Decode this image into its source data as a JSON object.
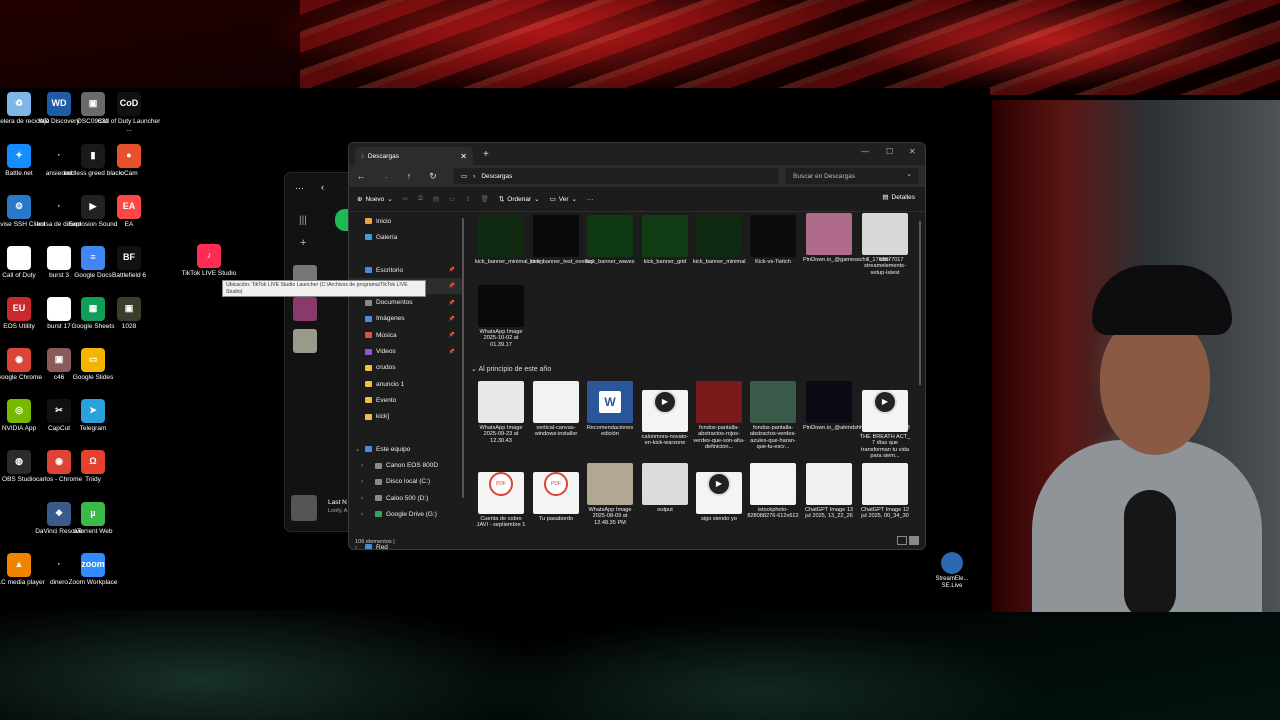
{
  "desktop_icons": [
    {
      "label": "Papelera de reciclaje",
      "icon": "recycle-bin-icon",
      "color": "#7fb6e8",
      "glyph": "♻"
    },
    {
      "label": "WD Discovery",
      "icon": "wd-icon",
      "color": "#1f5ca8",
      "glyph": "WD"
    },
    {
      "label": "DSC09631",
      "icon": "photo-icon",
      "color": "#6a6a6a",
      "glyph": "▣"
    },
    {
      "label": "Call of Duty Launcher ...",
      "icon": "cod-icon",
      "color": "#111111",
      "glyph": "CoD"
    },
    {
      "label": "Battle.net",
      "icon": "battlenet-icon",
      "color": "#148eff",
      "glyph": "✦"
    },
    {
      "label": "ansiedad",
      "icon": "file-icon",
      "color": "#000000",
      "glyph": "·"
    },
    {
      "label": "endless greed black",
      "icon": "file-icon",
      "color": "#1a1a1a",
      "glyph": "▮"
    },
    {
      "label": "oCam",
      "icon": "ocam-icon",
      "color": "#e9512c",
      "glyph": "●"
    },
    {
      "label": "Bitvise SSH Client",
      "icon": "bitvise-icon",
      "color": "#2a79c9",
      "glyph": "⚙"
    },
    {
      "label": "bolsa de dinero",
      "icon": "file-icon",
      "color": "#000000",
      "glyph": "·"
    },
    {
      "label": "Explosion Sound",
      "icon": "media-icon",
      "color": "#222222",
      "glyph": "▶"
    },
    {
      "label": "EA",
      "icon": "ea-icon",
      "color": "#ff4747",
      "glyph": "EA"
    },
    {
      "label": "Call of Duty",
      "icon": "document-icon",
      "color": "#ffffff",
      "glyph": "▤"
    },
    {
      "label": "burst 3",
      "icon": "document-icon",
      "color": "#ffffff",
      "glyph": "▤"
    },
    {
      "label": "Google Docs",
      "icon": "gdocs-icon",
      "color": "#4285f4",
      "glyph": "≡"
    },
    {
      "label": "Battlefield 6",
      "icon": "bf-icon",
      "color": "#111111",
      "glyph": "BF"
    },
    {
      "label": "EOS Utility",
      "icon": "eos-icon",
      "color": "#c9282d",
      "glyph": "EU"
    },
    {
      "label": "burst 17",
      "icon": "document-icon",
      "color": "#ffffff",
      "glyph": "▤"
    },
    {
      "label": "Google Sheets",
      "icon": "gsheets-icon",
      "color": "#0f9d58",
      "glyph": "▦"
    },
    {
      "label": "1028",
      "icon": "photo-icon",
      "color": "#3c3c2c",
      "glyph": "▣"
    },
    {
      "label": "Google Chrome",
      "icon": "chrome-icon",
      "color": "#db4437",
      "glyph": "◉"
    },
    {
      "label": "c46",
      "icon": "photo-icon",
      "color": "#8a5a5a",
      "glyph": "▣"
    },
    {
      "label": "Google Slides",
      "icon": "gslides-icon",
      "color": "#f4b400",
      "glyph": "▭"
    },
    {
      "label": "NVIDIA App",
      "icon": "nvidia-icon",
      "color": "#76b900",
      "glyph": "◎"
    },
    {
      "label": "CapCut",
      "icon": "capcut-icon",
      "color": "#111111",
      "glyph": "✂"
    },
    {
      "label": "Telegram",
      "icon": "telegram-icon",
      "color": "#2aa1da",
      "glyph": "➤"
    },
    {
      "label": "OBS Studio",
      "icon": "obs-icon",
      "color": "#2b2b2b",
      "glyph": "◍"
    },
    {
      "label": "carlos - Chrome",
      "icon": "chrome-profile-icon",
      "color": "#db4437",
      "glyph": "◉"
    },
    {
      "label": "Triidy",
      "icon": "triidy-icon",
      "color": "#e5412f",
      "glyph": "Ω"
    },
    {
      "label": "DaVinci Resolve",
      "icon": "davinci-icon",
      "color": "#3a5a8a",
      "glyph": "❖"
    },
    {
      "label": "uTorrent Web",
      "icon": "utorrent-icon",
      "color": "#3db64a",
      "glyph": "µ"
    },
    {
      "label": "VLC media player",
      "icon": "vlc-icon",
      "color": "#f08300",
      "glyph": "▲"
    },
    {
      "label": "dinero",
      "icon": "file-icon",
      "color": "#000000",
      "glyph": "·"
    },
    {
      "label": "Zoom Workplace",
      "icon": "zoom-icon",
      "color": "#2d8cff",
      "glyph": "zoom"
    },
    {
      "label": "TikTok LIVE Studio",
      "icon": "tiktok-live-icon",
      "color": "#fe2c55",
      "glyph": "♪"
    }
  ],
  "tooltip": "Ubicación: TikTok LIVE Studio Launcher (C:\\Archivos de programa\\TikTok LIVE Studio)",
  "spotify": {
    "now_playing_title": "Last N",
    "now_playing_artist": "Loofy, A"
  },
  "explorer": {
    "tab_title": "Descargas",
    "address": "Descargas",
    "search_placeholder": "Buscar en Descargas",
    "toolbar": {
      "new": "Nuevo",
      "sort": "Ordenar",
      "view": "Ver",
      "more": "···",
      "details": "Detalles"
    },
    "sidebar": [
      {
        "label": "Inicio",
        "icon": "home-icon",
        "color": "#f0a040"
      },
      {
        "label": "Galería",
        "icon": "gallery-icon",
        "color": "#3aa0e0"
      },
      {
        "label": "",
        "icon": "",
        "color": ""
      },
      {
        "label": "Escritorio",
        "icon": "desktop-icon",
        "color": "#4a8ae0",
        "pinned": true
      },
      {
        "label": "Descargas",
        "icon": "downloads-icon",
        "color": "#3aa850",
        "pinned": true
      },
      {
        "label": "Documentos",
        "icon": "documents-icon",
        "color": "#8a8a8a",
        "pinned": true
      },
      {
        "label": "Imágenes",
        "icon": "pictures-icon",
        "color": "#4a8ae0",
        "pinned": true
      },
      {
        "label": "Música",
        "icon": "music-icon",
        "color": "#e05050",
        "pinned": true
      },
      {
        "label": "Videos",
        "icon": "videos-icon",
        "color": "#9050e0",
        "pinned": true
      },
      {
        "label": "crudos",
        "icon": "folder-icon",
        "color": "#f0c040"
      },
      {
        "label": "anuncio 1",
        "icon": "folder-icon",
        "color": "#f0c040"
      },
      {
        "label": "Evento",
        "icon": "folder-icon",
        "color": "#f0c040"
      },
      {
        "label": "kick]",
        "icon": "folder-icon",
        "color": "#f0c040"
      },
      {
        "label": "",
        "icon": "",
        "color": ""
      },
      {
        "label": "Este equipo",
        "icon": "pc-icon",
        "color": "#4a8ae0",
        "expanded": true
      },
      {
        "label": "Canon EOS 800D",
        "icon": "camera-icon",
        "color": "#8a8a8a",
        "child": true
      },
      {
        "label": "Disco local (C:)",
        "icon": "drive-icon",
        "color": "#8a8a8a",
        "child": true
      },
      {
        "label": "Caloo 500 (D:)",
        "icon": "drive-icon",
        "color": "#8a8a8a",
        "child": true
      },
      {
        "label": "Google Drive (G:)",
        "icon": "gdrive-icon",
        "color": "#34a853",
        "child": true
      },
      {
        "label": "",
        "icon": "",
        "color": ""
      },
      {
        "label": "Red",
        "icon": "network-icon",
        "color": "#4a8ae0"
      }
    ],
    "section_label": "Al principio de este año",
    "files_recent": [
      {
        "name": "kick_banner_minimal_neon",
        "thumb": "#0f2a10"
      },
      {
        "name": "kick_banner_text_overlay",
        "thumb": "#0a0a0a"
      },
      {
        "name": "kick_banner_waves",
        "thumb": "#0e3a12"
      },
      {
        "name": "kick_banner_grid",
        "thumb": "#123c14"
      },
      {
        "name": "kick_banner_minimal",
        "thumb": "#0f2a10"
      },
      {
        "name": "Kick-vs-Twitch",
        "thumb": "#0c0c0c"
      },
      {
        "name": "PinDown.io_@gamesschill_1760877017",
        "thumb": "#b06a8a"
      },
      {
        "name": "obs-streamelements-setup-latest",
        "thumb": "#d8d8d8"
      },
      {
        "name": "WhatsApp Image 2025-10-02 at 01.39.17",
        "thumb": "#0a0a0a"
      }
    ],
    "files_year": [
      {
        "name": "WhatsApp Image 2025-09-23 at 12.30.43",
        "thumb": "#e8e8e8"
      },
      {
        "name": "vertical-canvas-windows-installer",
        "thumb": "#f2f2f2"
      },
      {
        "name": "Recomendaciones edición",
        "thumb": "#2b579a"
      },
      {
        "name": "caloomora-novato-en-kick-warzone",
        "thumb": "#f4f4f4"
      },
      {
        "name": "fondos-pantalla-abstractos-rojos-verdes-que-son-alta-definicion...",
        "thumb": "#7a1a1a"
      },
      {
        "name": "fondos-pantalla-abstractos-verdes-azules-que-haran-que-tu-escr...",
        "thumb": "#3a5a4a"
      },
      {
        "name": "PinDown.io_@ahmdshhd649_1758135728",
        "thumb": "#0a0a14"
      },
      {
        "name": "THE BREATH ACT_ 7 días que transforman tu vida para siem...",
        "thumb": "#f4f4f4"
      },
      {
        "name": "Cuenta de cobro JAVI - septiembre 1",
        "thumb": "#f4f4f4"
      },
      {
        "name": "Tu pasabordo",
        "thumb": "#f4f4f4"
      },
      {
        "name": "WhatsApp Image 2025-08-09 at 12.48.35 PM",
        "thumb": "#b0a890"
      },
      {
        "name": "output",
        "thumb": "#dcdcdc"
      },
      {
        "name": "sigo siendo yo",
        "thumb": "#f4f4f4"
      },
      {
        "name": "istockphoto-828088276-612x612",
        "thumb": "#f4f4f4"
      },
      {
        "name": "ChatGPT Image 13 jul 2025, 13_22_26",
        "thumb": "#f0f0f0"
      },
      {
        "name": "ChatGPT Image 12 jul 2025, 00_34_30",
        "thumb": "#f0f0f0"
      }
    ],
    "status": "106 elementos  |"
  },
  "streamelements": {
    "label": "StreamEle... SE.Live"
  }
}
